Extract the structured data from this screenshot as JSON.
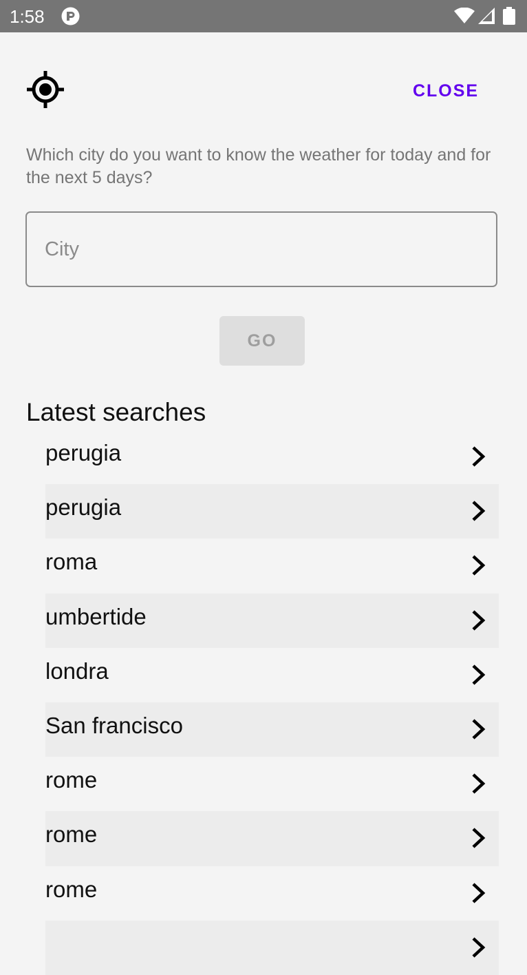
{
  "status_bar": {
    "time": "1:58",
    "app_icon": "app-notification-icon",
    "wifi_icon": "wifi-icon",
    "signal_icon": "cell-signal-icon",
    "battery_icon": "battery-icon"
  },
  "header": {
    "locate_icon": "my-location-icon",
    "close_label": "CLOSE"
  },
  "search": {
    "prompt": "Which city do you want to know the weather for today and for the next 5 days?",
    "placeholder": "City",
    "value": "",
    "go_label": "GO"
  },
  "latest": {
    "title": "Latest searches",
    "items": [
      {
        "label": "perugia"
      },
      {
        "label": "perugia"
      },
      {
        "label": "roma"
      },
      {
        "label": "umbertide"
      },
      {
        "label": "londra"
      },
      {
        "label": "San francisco"
      },
      {
        "label": "rome"
      },
      {
        "label": "rome"
      },
      {
        "label": "rome"
      }
    ]
  },
  "colors": {
    "accent": "#6200ee",
    "status_bar": "#757575",
    "background": "#f4f4f4",
    "row_alt": "#ececec",
    "disabled_button": "#dedede"
  }
}
